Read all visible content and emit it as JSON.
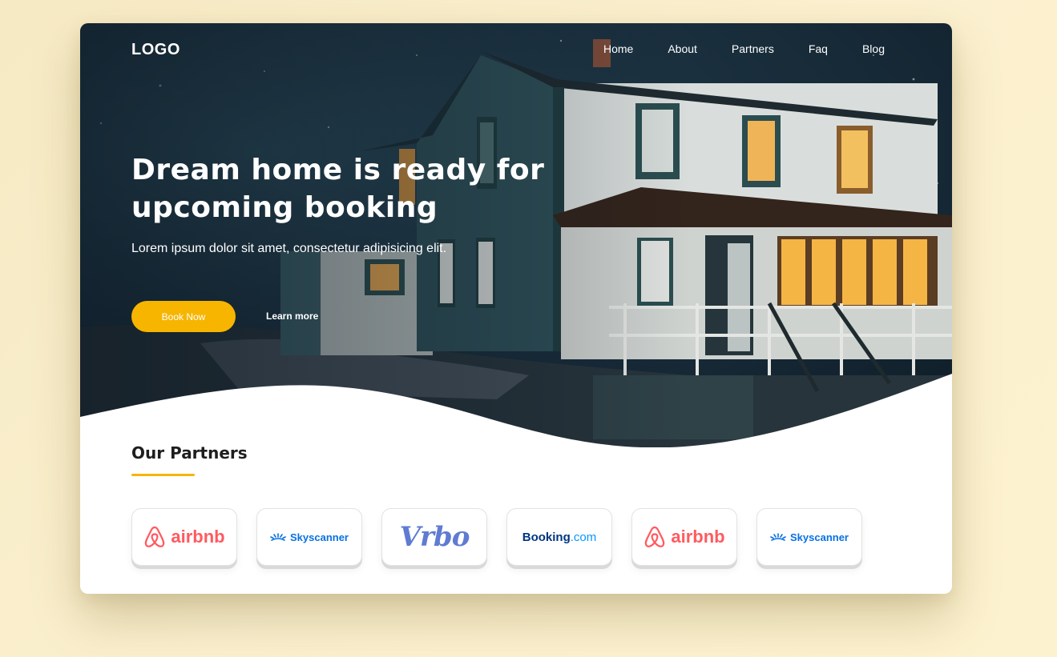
{
  "nav": {
    "logo": "LOGO",
    "items": [
      "Home",
      "About",
      "Partners",
      "Faq",
      "Blog"
    ]
  },
  "hero": {
    "headline_line1": "Dream home is ready for",
    "headline_line2": "upcoming booking",
    "subtitle": "Lorem ipsum dolor sit amet, consectetur adipisicing elit.",
    "primary_cta": "Book Now",
    "secondary_cta": "Learn more"
  },
  "partners": {
    "title": "Our Partners",
    "logos": [
      {
        "name": "airbnb",
        "text": "airbnb",
        "icon": "airbnb-icon"
      },
      {
        "name": "skyscanner",
        "text": "Skyscanner",
        "icon": "skyscanner-icon"
      },
      {
        "name": "vrbo",
        "text": "Vrbo"
      },
      {
        "name": "booking",
        "text_main": "Booking",
        "text_suffix": ".com"
      },
      {
        "name": "airbnb",
        "text": "airbnb",
        "icon": "airbnb-icon"
      },
      {
        "name": "skyscanner",
        "text": "Skyscanner",
        "icon": "skyscanner-icon"
      }
    ]
  },
  "colors": {
    "accent": "#f7b500",
    "page_bg": "#fbf0cf",
    "airbnb": "#ff5a5f",
    "skyscanner": "#0770e3",
    "vrbo": "#5f7bd2",
    "booking": "#003580"
  }
}
